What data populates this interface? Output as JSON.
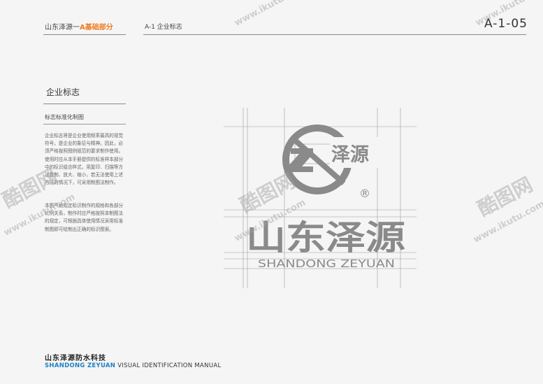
{
  "header": {
    "brand": "山东泽源一",
    "section": "A基础部分",
    "mid": "A-1   企业标志",
    "code": "A-1-05"
  },
  "sidebar": {
    "title": "企业标志",
    "subtitle": "标志标准化制图",
    "paragraph1": "企业标志将是企业使用频率最高的视觉符号，是企业的象征与精神。因此，必须严格按照图例规范的要求制作使用。使用时应从本手册提供的标准样本部分中的标识组合样式，用复印、扫描等方法复制、放大、缩小，若无法使用上述方法的情况下，可采用制图法制作。",
    "paragraph2": "本图严格规定标识制作的规格和各部分比例关系，制作时应严格按照本制图法的规定，可根据具体使用情况采用标准制图即可绘制出正确的标识图案。"
  },
  "logo": {
    "mark_text": "泽源",
    "registered": "®",
    "chinese_name": "山东泽源",
    "english_name": "SHANDONG ZEYUAN"
  },
  "footer": {
    "company_cn": "山东泽源防水科技",
    "company_en": "SHANDONG ZEYUAN",
    "manual": " VISUAL IDENTIFICATION MANUAL"
  },
  "watermark": {
    "brand": "酷图网",
    "url": "www.ikutu.com"
  },
  "colors": {
    "accent": "#ef7d22",
    "blue": "#1d7fc2",
    "logo_gray": "#8a8a8a"
  }
}
